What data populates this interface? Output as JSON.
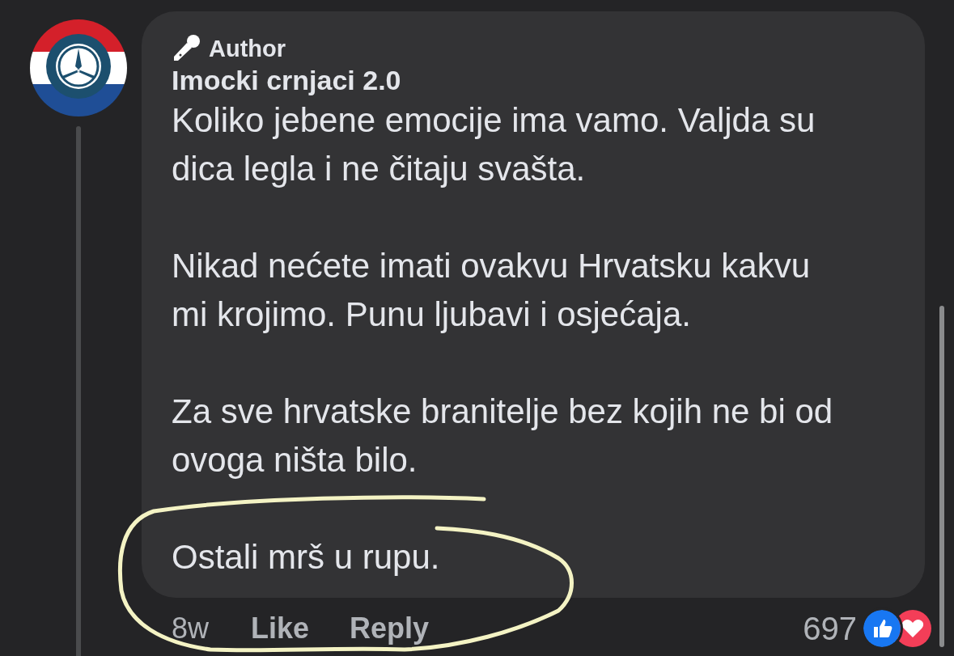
{
  "comment": {
    "badge": "Author",
    "author": "Imocki crnjaci 2.0",
    "paragraphs": [
      "Koliko jebene emocije ima vamo. Valjda su dica legla i ne čitaju svašta.",
      "Nikad nećete imati ovakvu Hrvatsku kakvu mi krojimo. Punu ljubavi i osjećaja.",
      "Za sve hrvatske branitelje bez kojih ne bi od ovoga ništa bilo.",
      "Ostali mrš u rupu."
    ],
    "time": "8w",
    "actions": [
      "Like",
      "Reply"
    ],
    "reaction_count": "697"
  }
}
